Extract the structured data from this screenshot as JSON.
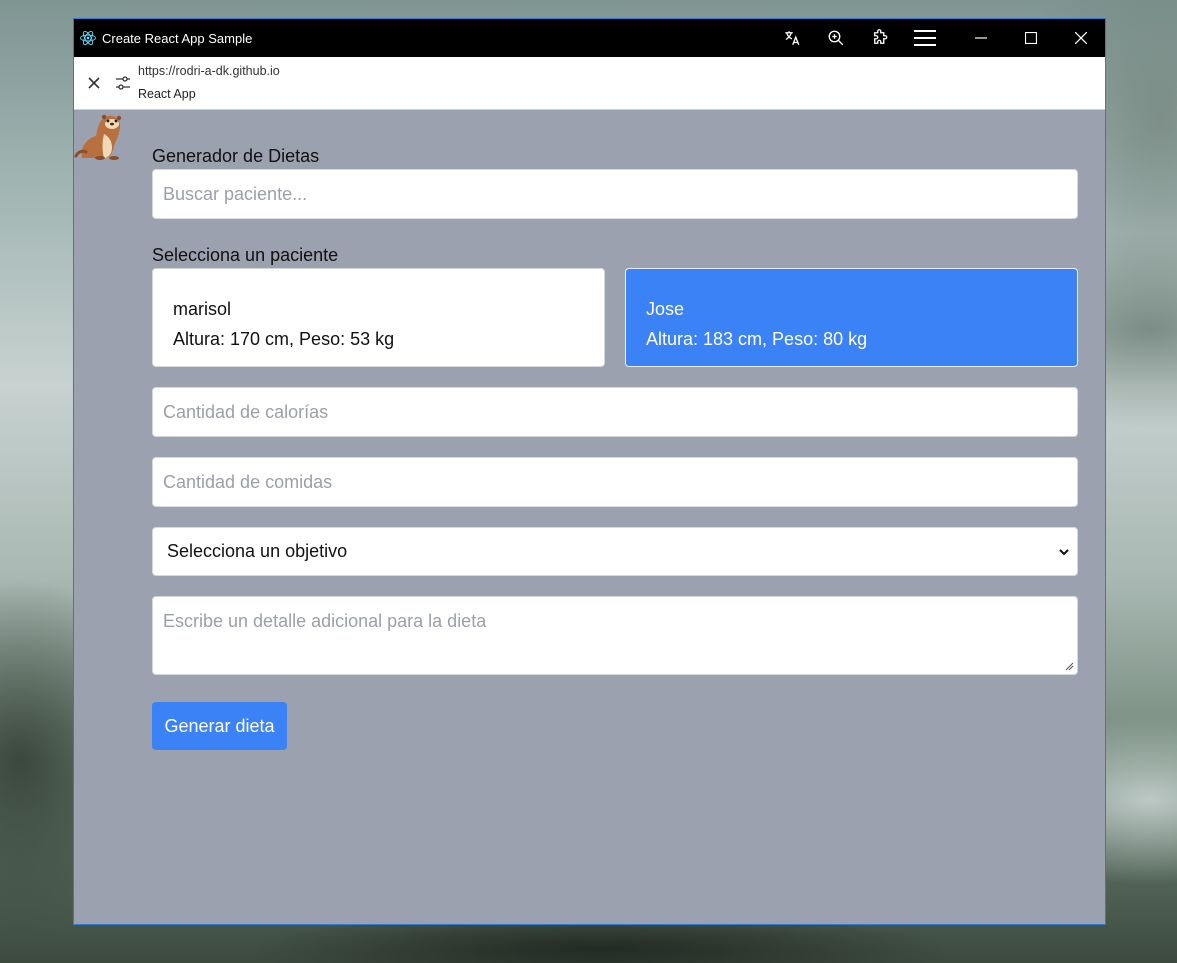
{
  "window": {
    "title": "Create React App Sample"
  },
  "address_bar": {
    "url": "https://rodri-a-dk.github.io",
    "page_title": "React App"
  },
  "app": {
    "heading": "Generador de Dietas",
    "search_placeholder": "Buscar paciente...",
    "select_patient_label": "Selecciona un paciente",
    "patients": [
      {
        "name": "marisol",
        "details": "Altura: 170 cm, Peso: 53 kg",
        "selected": false
      },
      {
        "name": "Jose",
        "details": "Altura: 183 cm, Peso: 80 kg",
        "selected": true
      }
    ],
    "calories_placeholder": "Cantidad de calorías",
    "meals_placeholder": "Cantidad de comidas",
    "objective_value": "Selecciona un objetivo",
    "details_placeholder": "Escribe un detalle adicional para la dieta",
    "generate_button": "Generar dieta"
  },
  "colors": {
    "accent": "#3b82f6",
    "page_background": "#9ba1ae",
    "titlebar": "#000000",
    "window_border": "#2d7ad6"
  }
}
